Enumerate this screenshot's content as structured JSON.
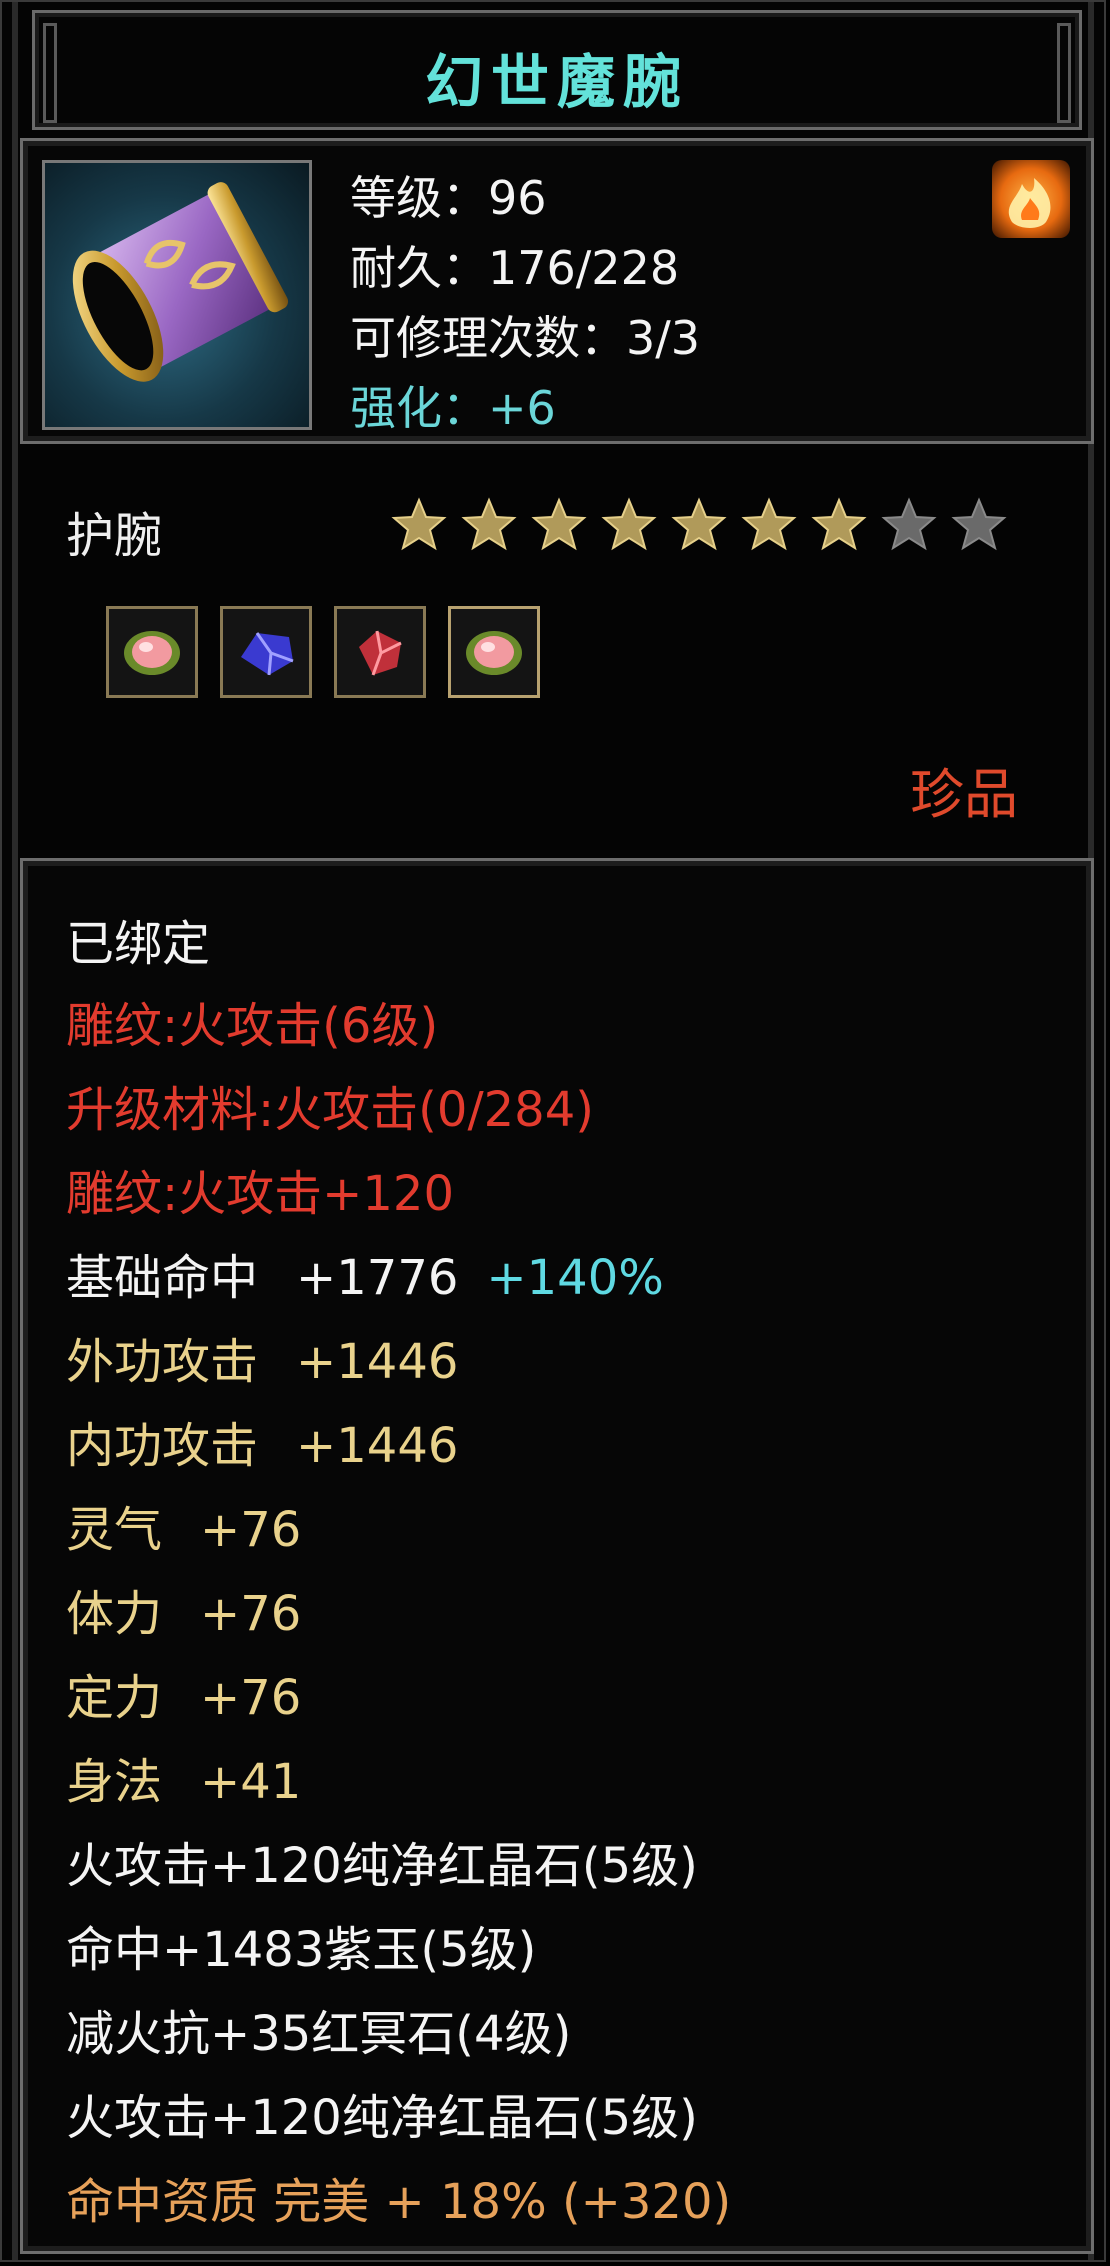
{
  "item": {
    "name": "幻世魔腕",
    "level_text": "等级：96",
    "durability_text": "耐久：176/228",
    "repair_text": "可修理次数：3/3",
    "enhance_text": "强化：+6",
    "type": "护腕",
    "stars_filled": 7,
    "stars_total": 9,
    "quality": "珍品",
    "icon": "purple-bracer-icon",
    "corner_icon": "fire-element-icon",
    "gems": [
      "pink-gem-icon",
      "blue-gem-icon",
      "red-gem-icon",
      "pink-gem-icon"
    ]
  },
  "attributes": {
    "bound": "已绑定",
    "engrave1": "雕纹:火攻击(6级)",
    "upgrade": "升级材料:火攻击(0/284)",
    "engrave2": "雕纹:火攻击+120",
    "hit_label": "基础命中",
    "hit_value": "+1776",
    "hit_bonus": "+140%",
    "ext_label": "外功攻击",
    "ext_value": "+1446",
    "int_label": "内功攻击",
    "int_value": "+1446",
    "spirit_label": "灵气",
    "spirit_value": "+76",
    "vit_label": "体力",
    "vit_value": "+76",
    "focus_label": "定力",
    "focus_value": "+76",
    "agi_label": "身法",
    "agi_value": "+41",
    "gem1": "火攻击+120纯净红晶石(5级)",
    "gem2": "命中+1483紫玉(5级)",
    "gem3": "减火抗+35红冥石(4级)",
    "gem4": "火攻击+120纯净红晶石(5级)",
    "aptitude": "命中资质 完美 + 18% (+320)"
  },
  "colors": {
    "title": "#63e2da",
    "red": "#e23b2e",
    "gold": "#e9d28c",
    "orange": "#e6a15a",
    "cyan": "#5fd9e2",
    "quality": "#e04a2c",
    "star_filled": "#b09a5a",
    "star_empty": "#6a6a6a"
  }
}
